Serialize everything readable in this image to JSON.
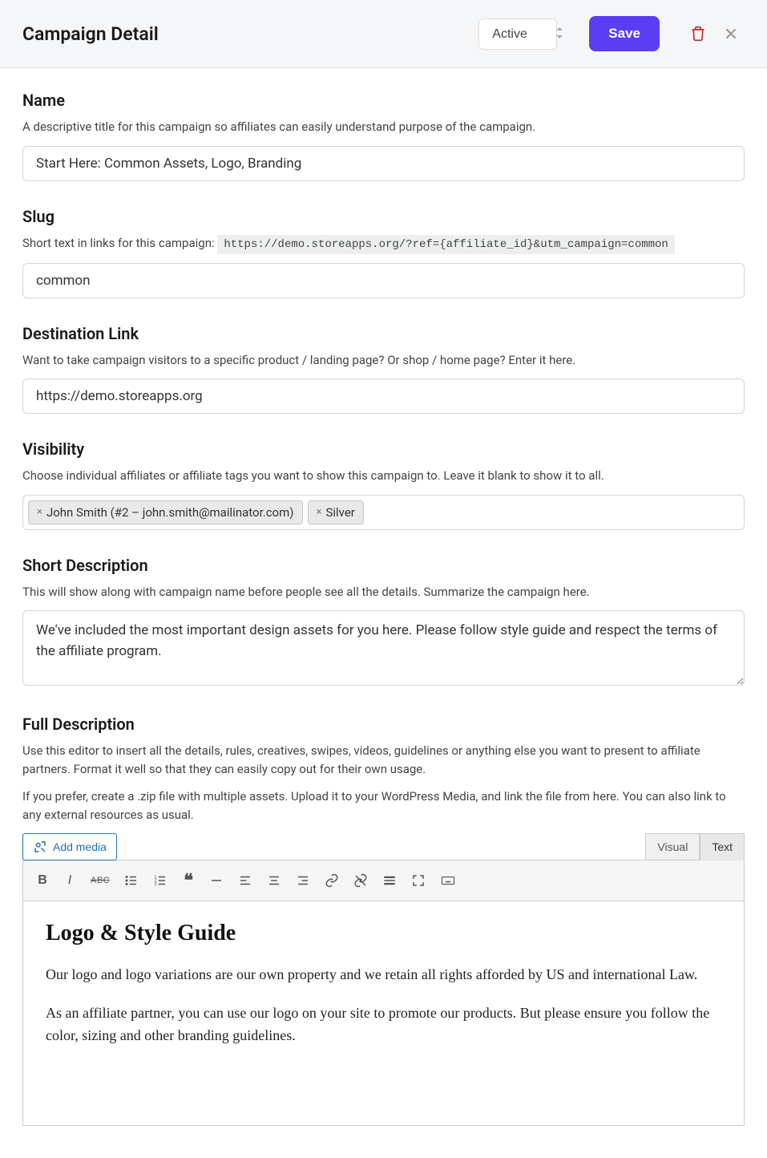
{
  "header": {
    "title": "Campaign Detail",
    "status": "Active",
    "save_label": "Save"
  },
  "fields": {
    "name": {
      "label": "Name",
      "help": "A descriptive title for this campaign so affiliates can easily understand purpose of the campaign.",
      "value": "Start Here: Common Assets, Logo, Branding"
    },
    "slug": {
      "label": "Slug",
      "help_prefix": "Short text in links for this campaign: ",
      "help_code": "https://demo.storeapps.org/?ref={affiliate_id}&utm_campaign=common",
      "value": "common"
    },
    "destination": {
      "label": "Destination Link",
      "help": "Want to take campaign visitors to a specific product / landing page? Or shop / home page? Enter it here.",
      "value": "https://demo.storeapps.org"
    },
    "visibility": {
      "label": "Visibility",
      "help": "Choose individual affiliates or affiliate tags you want to show this campaign to. Leave it blank to show it to all.",
      "tags": [
        "John Smith (#2 – john.smith@mailinator.com)",
        "Silver"
      ]
    },
    "short_desc": {
      "label": "Short Description",
      "help": "This will show along with campaign name before people see all the details. Summarize the campaign here.",
      "value": "We've included the most important design assets for you here. Please follow style guide and respect the terms of the affiliate program."
    },
    "full_desc": {
      "label": "Full Description",
      "help1": "Use this editor to insert all the details, rules, creatives, swipes, videos, guidelines or anything else you want to present to affiliate partners. Format it well so that they can easily copy out for their own usage.",
      "help2": "If you prefer, create a .zip file with multiple assets. Upload it to your WordPress Media, and link the file from here. You can also link to any external resources as usual.",
      "add_media": "Add media",
      "tab_visual": "Visual",
      "tab_text": "Text",
      "content_heading": "Logo & Style Guide",
      "content_p1": "Our logo and logo variations are our own property and we retain all rights afforded by US and international Law.",
      "content_p2": "As an affiliate partner, you can use our logo on your site to promote our products. But please ensure you follow the color, sizing and other branding guidelines."
    }
  }
}
